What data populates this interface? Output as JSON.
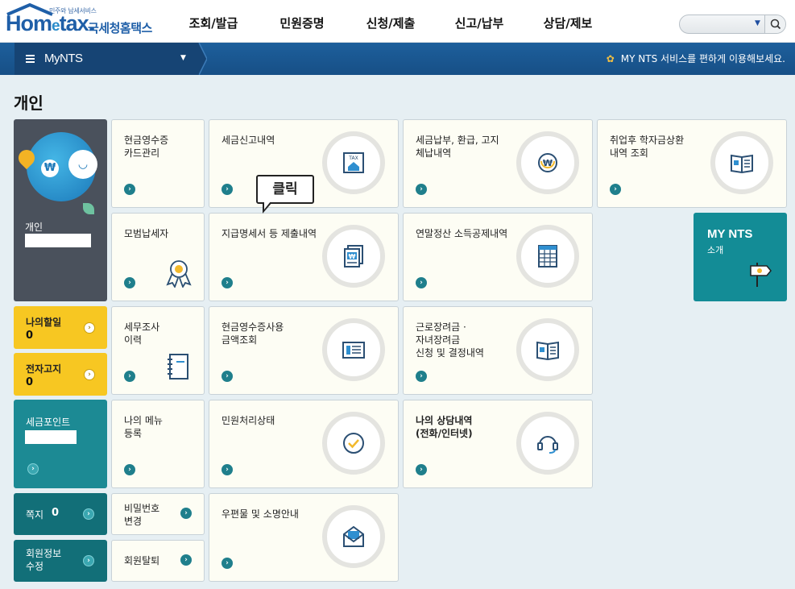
{
  "header": {
    "tagline": "민주와 납세서비스",
    "brand_main": "Hom",
    "brand_e": "e",
    "brand_tail": "tax.",
    "brand_sub": "국세청홈택스",
    "nav": [
      "조회/발급",
      "민원증명",
      "신청/제출",
      "신고/납부",
      "상담/제보"
    ],
    "search_placeholder": ""
  },
  "mybar": {
    "label": "MyNTS",
    "notice": "MY NTS 서비스를 편하게 이용해보세요."
  },
  "section_title": "개인",
  "profile": {
    "name": "개인"
  },
  "left": {
    "todo": {
      "label": "나의할일",
      "count": "0"
    },
    "notice": {
      "label": "전자고지",
      "count": "0"
    },
    "points": {
      "label": "세금포인트"
    },
    "memo": {
      "label": "쪽지",
      "count": "0"
    },
    "member_edit": {
      "label": "회원정보\n수정"
    }
  },
  "cards": {
    "cash_card": "현금영수증\n카드관리",
    "tax_return": "세금신고내역",
    "tax_payment": "세금납부, 환급, 고지\n체납내역",
    "student_loan": "취업후 학자금상환\n내역 조회",
    "model_taxpayer": "모범납세자",
    "payment_statement": "지급명세서 등 제출내역",
    "year_end": "연말정산 소득공제내역",
    "tax_audit": "세무조사\n이력",
    "cash_usage": "현금영수증사용\n금액조회",
    "earned_income": "근로장려금 ·\n자녀장려금\n신청 및 결정내역",
    "my_menu": "나의 메뉴\n등록",
    "civil_status": "민원처리상태",
    "my_consult": "나의 상담내역\n(전화/인터넷)",
    "password": "비밀번호\n변경",
    "withdraw": "회원탈퇴",
    "mail": "우편물 및 소명안내"
  },
  "mynts": {
    "title": "MY NTS",
    "sub": "소개"
  },
  "callout": "클릭",
  "icons": {
    "tax_box_text": "TAX",
    "won": "₩"
  }
}
